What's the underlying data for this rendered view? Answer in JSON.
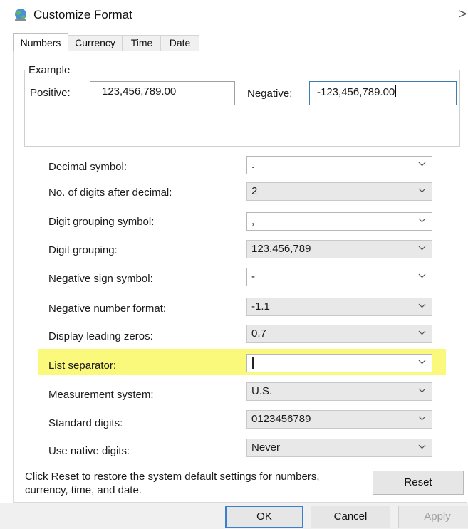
{
  "window": {
    "title": "Customize Format",
    "close_glyph": ">"
  },
  "tabs": [
    {
      "label": "Numbers",
      "active": true
    },
    {
      "label": "Currency",
      "active": false
    },
    {
      "label": "Time",
      "active": false
    },
    {
      "label": "Date",
      "active": false
    }
  ],
  "example": {
    "legend": "Example",
    "positive_label": "Positive:",
    "positive_value": "123,456,789.00",
    "negative_label": "Negative:",
    "negative_value": "-123,456,789.00"
  },
  "settings": [
    {
      "label": "Decimal symbol:",
      "value": ".",
      "editable": true
    },
    {
      "label": "No. of digits after decimal:",
      "value": "2",
      "editable": false
    },
    {
      "label": "Digit grouping symbol:",
      "value": ",",
      "editable": true
    },
    {
      "label": "Digit grouping:",
      "value": "123,456,789",
      "editable": false
    },
    {
      "label": "Negative sign symbol:",
      "value": "-",
      "editable": true
    },
    {
      "label": "Negative number format:",
      "value": "-1.1",
      "editable": false
    },
    {
      "label": "Display leading zeros:",
      "value": "0.7",
      "editable": false
    },
    {
      "label": "List separator:",
      "value": "",
      "editable": true,
      "highlighted": true,
      "highlight_color": "#fbf97c"
    },
    {
      "label": "Measurement system:",
      "value": "U.S.",
      "editable": false
    },
    {
      "label": "Standard digits:",
      "value": "0123456789",
      "editable": false
    },
    {
      "label": "Use native digits:",
      "value": "Never",
      "editable": false
    }
  ],
  "footer": {
    "info_text": "Click Reset to restore the system default settings for numbers, currency, time, and date.",
    "reset_label": "Reset"
  },
  "buttons": {
    "ok_label": "OK",
    "cancel_label": "Cancel",
    "apply_label": "Apply"
  },
  "colors": {
    "accent": "#3b7fd0",
    "highlight": "#fbf97c"
  },
  "icons": {
    "app": "region-globe-icon",
    "close": "close-icon",
    "dropdown": "chevron-down-icon"
  }
}
